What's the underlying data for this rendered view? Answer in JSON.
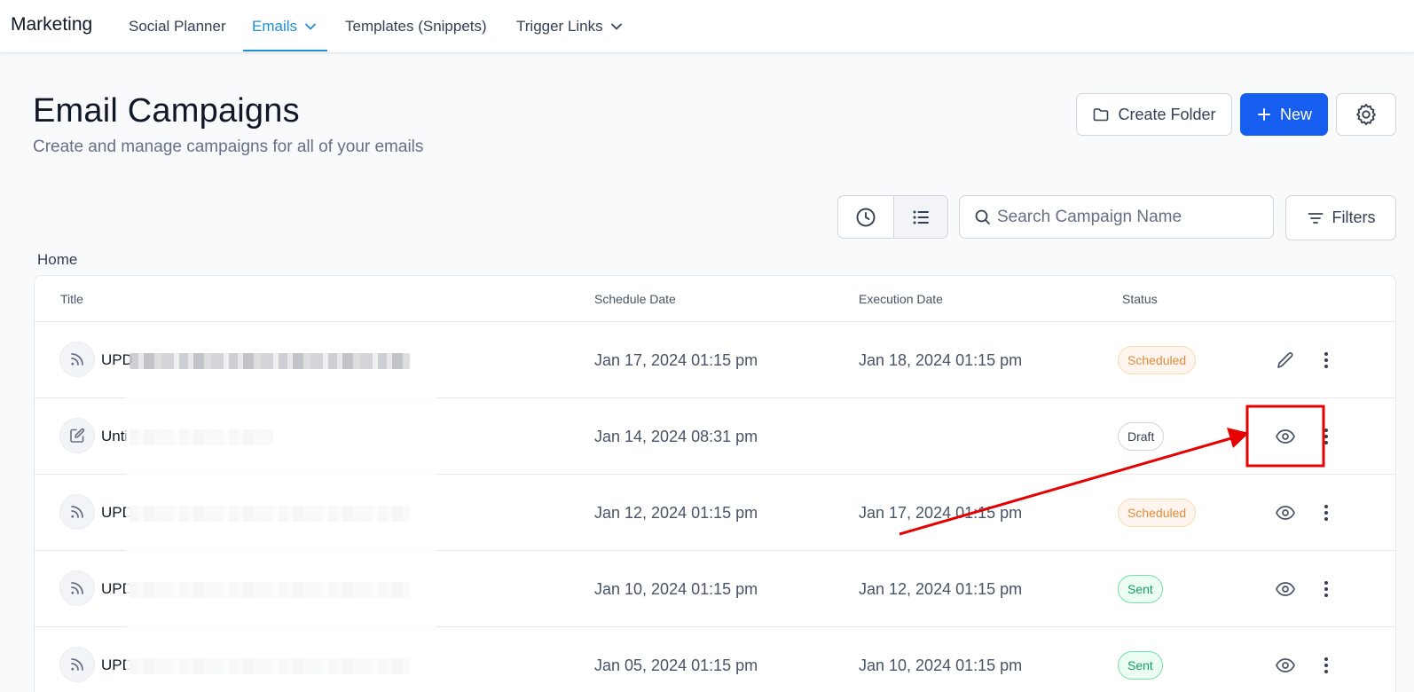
{
  "nav": {
    "brand": "Marketing",
    "items": [
      {
        "label": "Social Planner"
      },
      {
        "label": "Emails"
      },
      {
        "label": "Templates (Snippets)"
      },
      {
        "label": "Trigger Links"
      }
    ]
  },
  "header": {
    "title": "Email Campaigns",
    "subtitle": "Create and manage campaigns for all of your emails",
    "create_folder_label": "Create Folder",
    "new_label": "New"
  },
  "toolbar": {
    "search_placeholder": "Search Campaign Name",
    "filters_label": "Filters"
  },
  "breadcrumb": "Home",
  "table": {
    "columns": [
      "Title",
      "Schedule Date",
      "Execution Date",
      "Status"
    ],
    "rows": [
      {
        "title_prefix": "UPD",
        "icon": "rss-icon",
        "schedule": "Jan 17, 2024 01:15 pm",
        "execution": "Jan 18, 2024 01:15 pm",
        "status": "Scheduled",
        "action": "edit"
      },
      {
        "title_prefix": "Unti",
        "icon": "edit-icon",
        "schedule": "Jan 14, 2024 08:31 pm",
        "execution": "",
        "status": "Draft",
        "action": "view"
      },
      {
        "title_prefix": "UPD",
        "icon": "rss-icon",
        "schedule": "Jan 12, 2024 01:15 pm",
        "execution": "Jan 17, 2024 01:15 pm",
        "status": "Scheduled",
        "action": "view"
      },
      {
        "title_prefix": "UPD",
        "icon": "rss-icon",
        "schedule": "Jan 10, 2024 01:15 pm",
        "execution": "Jan 12, 2024 01:15 pm",
        "status": "Sent",
        "action": "view"
      },
      {
        "title_prefix": "UPD",
        "icon": "rss-icon",
        "schedule": "Jan 05, 2024 01:15 pm",
        "execution": "Jan 10, 2024 01:15 pm",
        "status": "Sent",
        "action": "view"
      }
    ]
  },
  "colors": {
    "accent": "#1d8fd6",
    "primary_button": "#155eef",
    "annotation": "#e60000"
  }
}
